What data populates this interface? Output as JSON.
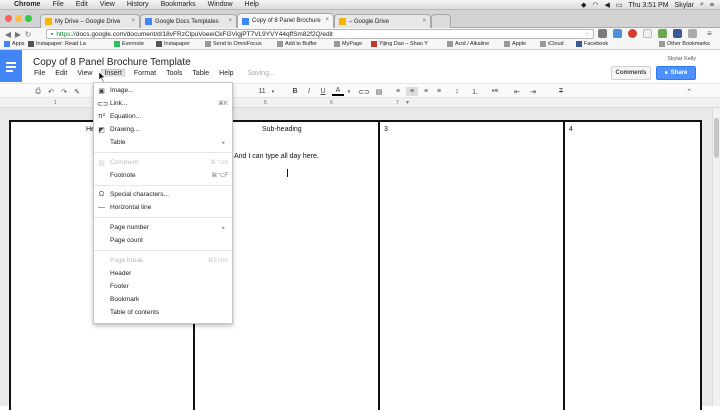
{
  "mac_menubar": {
    "app": "Chrome",
    "items": [
      "File",
      "Edit",
      "View",
      "History",
      "Bookmarks",
      "Window",
      "Help"
    ],
    "clock": "Thu 3:51 PM",
    "user": "Skylar"
  },
  "browser": {
    "tabs": [
      {
        "title": "My Drive – Google Drive",
        "color": "#f4b400"
      },
      {
        "title": "Google Docs Templates",
        "color": "#4285f4"
      },
      {
        "title": "Copy of 8 Panel Brochure",
        "color": "#4285f4"
      },
      {
        "title": "– Google Drive",
        "color": "#f4b400"
      }
    ],
    "url_scheme": "https://",
    "url_rest": "docs.google.com/document/d/18vFRzClpuVoeeiCkFGVigjPT7VL9YVY44qffSm82f2Q/edit",
    "bookmarks": [
      "Apps",
      "Instapaper: Read La",
      "Evernote",
      "Instapaper",
      "Send to OmniFocus",
      "Add to Buffer",
      "MyPage",
      "Yijing Dao – Shao Y",
      "Acid / Alkaline",
      "Apple",
      "iCloud",
      "Facebook"
    ],
    "other_bookmarks": "Other Bookmarks"
  },
  "docs": {
    "title": "Copy of 8 Panel Brochure Template",
    "menus": [
      "File",
      "Edit",
      "View",
      "Insert",
      "Format",
      "Tools",
      "Table",
      "Help"
    ],
    "status": "Saving...",
    "user": "Skylar Kelly",
    "comments_label": "Comments",
    "share_label": "Share",
    "toolbar": {
      "font_size": "11",
      "bold": "B",
      "italic": "I",
      "underline": "U",
      "text_color": "A"
    },
    "ruler_marks": [
      "1",
      "5",
      "6",
      "7"
    ],
    "panels": {
      "panel1_heading": "He",
      "panel2_heading": "Sub-heading",
      "panel2_body": "And I can type all day here.",
      "panel3_number": "3",
      "panel4_number": "4"
    },
    "insert_menu": {
      "items": [
        {
          "label": "Image...",
          "icon": "image-icon"
        },
        {
          "label": "Link...",
          "shortcut": "⌘K",
          "icon": "link-icon"
        },
        {
          "label": "Equation...",
          "icon": "equation-icon"
        },
        {
          "label": "Drawing...",
          "icon": "drawing-icon"
        },
        {
          "label": "Table",
          "submenu": "▸"
        },
        {
          "label": "Comment",
          "shortcut": "⌘⌥M",
          "disabled": true,
          "icon": "comment-icon"
        },
        {
          "label": "Footnote",
          "shortcut": "⌘⌥F"
        },
        {
          "label": "Special characters...",
          "icon": "omega-icon"
        },
        {
          "label": "Horizontal line",
          "icon": "line-icon"
        },
        {
          "label": "Page number",
          "submenu": "▸"
        },
        {
          "label": "Page count"
        },
        {
          "label": "Page break",
          "shortcut": "⌘Enter",
          "disabled": true
        },
        {
          "label": "Header"
        },
        {
          "label": "Footer"
        },
        {
          "label": "Bookmark"
        },
        {
          "label": "Table of contents"
        }
      ]
    }
  }
}
